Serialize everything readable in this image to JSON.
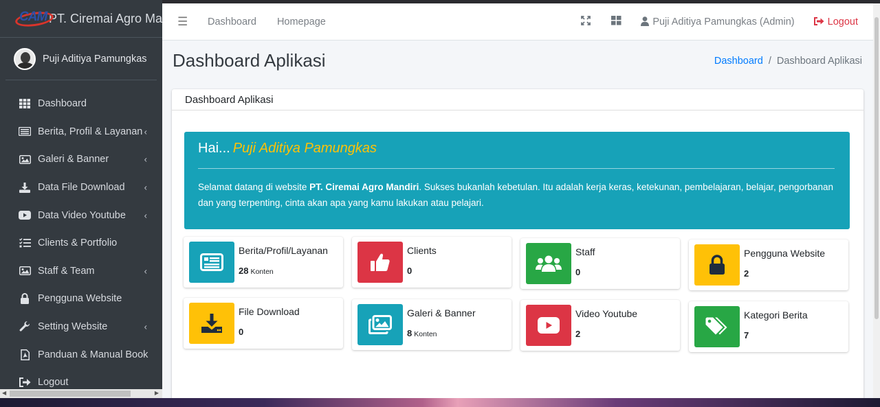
{
  "brand": {
    "name": "PT. Ciremai Agro Ma",
    "logo_text": "CAM"
  },
  "user_panel": {
    "name": "Puji Aditiya Pamungkas"
  },
  "sidebar": {
    "items": [
      {
        "label": "Dashboard",
        "icon": "th-icon",
        "has_children": false
      },
      {
        "label": "Berita, Profil & Layanan",
        "icon": "newspaper-icon",
        "has_children": true
      },
      {
        "label": "Galeri & Banner",
        "icon": "image-icon",
        "has_children": true
      },
      {
        "label": "Data File Download",
        "icon": "download-icon",
        "has_children": true
      },
      {
        "label": "Data Video Youtube",
        "icon": "youtube-icon",
        "has_children": true
      },
      {
        "label": "Clients & Portfolio",
        "icon": "tasks-icon",
        "has_children": false
      },
      {
        "label": "Staff & Team",
        "icon": "image-icon",
        "has_children": true
      },
      {
        "label": "Pengguna Website",
        "icon": "lock-icon",
        "has_children": false
      },
      {
        "label": "Setting Website",
        "icon": "wrench-icon",
        "has_children": true
      },
      {
        "label": "Panduan & Manual Book",
        "icon": "file-pdf-icon",
        "has_children": false
      },
      {
        "label": "Logout",
        "icon": "sign-out-icon",
        "has_children": false
      }
    ]
  },
  "topbar": {
    "links": [
      "Dashboard",
      "Homepage"
    ],
    "user": "Puji Aditiya Pamungkas (Admin)",
    "logout": "Logout"
  },
  "page": {
    "title": "Dashboard Aplikasi",
    "breadcrumb": {
      "home": "Dashboard",
      "current": "Dashboard Aplikasi"
    },
    "card_title": "Dashboard Aplikasi"
  },
  "welcome": {
    "greeting": "Hai...",
    "name": "Puji Aditiya Pamungkas",
    "msg_prefix": "Selamat datang di website ",
    "msg_company": "PT. Ciremai Agro Mandiri",
    "msg_suffix": ". Sukses bukanlah kebetulan. Itu adalah kerja keras, ketekunan, pembelajaran, belajar, pengorbanan dan yang terpenting, cinta akan apa yang kamu lakukan atau pelajari."
  },
  "info_boxes": [
    {
      "label": "Berita/Profil/Layanan",
      "value": "28",
      "unit": "Konten",
      "color": "#17a2b8",
      "icon": "newspaper-icon"
    },
    {
      "label": "Clients",
      "value": "0",
      "unit": "",
      "color": "#dc3545",
      "icon": "thumbs-up-icon"
    },
    {
      "label": "Staff",
      "value": "0",
      "unit": "",
      "color": "#28a745",
      "icon": "users-icon"
    },
    {
      "label": "Pengguna Website",
      "value": "2",
      "unit": "",
      "color": "#ffc107",
      "icon": "lock-icon"
    },
    {
      "label": "File Download",
      "value": "0",
      "unit": "",
      "color": "#ffc107",
      "icon": "download-icon"
    },
    {
      "label": "Galeri & Banner",
      "value": "8",
      "unit": "Konten",
      "color": "#17a2b8",
      "icon": "images-icon"
    },
    {
      "label": "Video Youtube",
      "value": "2",
      "unit": "",
      "color": "#dc3545",
      "icon": "youtube-icon"
    },
    {
      "label": "Kategori Berita",
      "value": "7",
      "unit": "",
      "color": "#28a745",
      "icon": "tags-icon"
    }
  ]
}
